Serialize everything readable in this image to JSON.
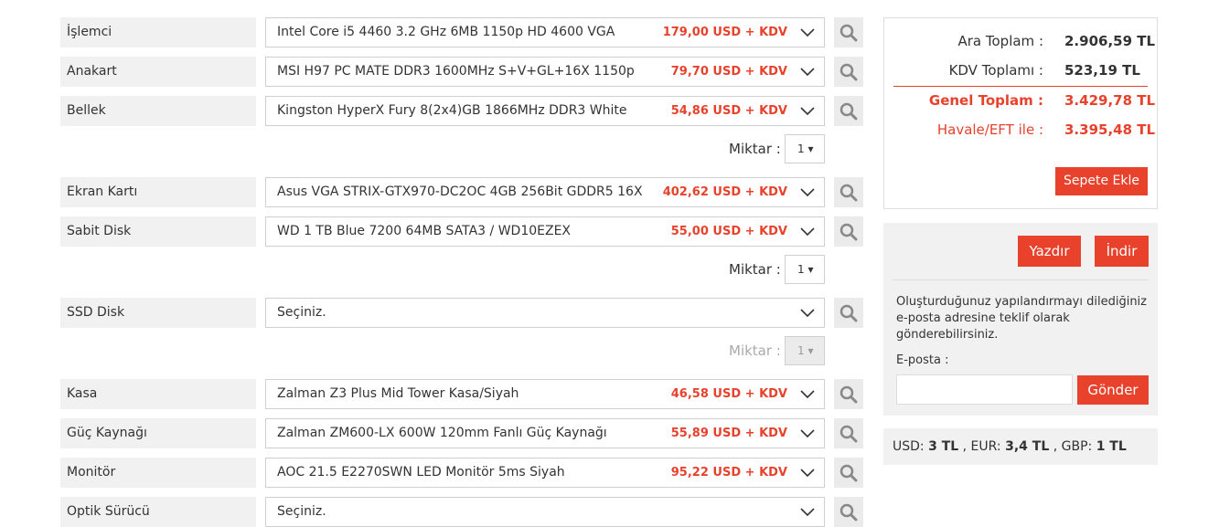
{
  "components": [
    {
      "label": "İşlemci",
      "product": "Intel Core i5 4460 3.2 GHz 6MB 1150p HD 4600 VGA",
      "price": "179,00 USD + KDV"
    },
    {
      "label": "Anakart",
      "product": "MSI H97 PC MATE DDR3 1600MHz S+V+GL+16X 1150p",
      "price": "79,70 USD + KDV"
    },
    {
      "label": "Bellek",
      "product": "Kingston HyperX Fury 8(2x4)GB 1866MHz DDR3 White",
      "price": "54,86 USD + KDV"
    },
    {
      "label": "Ekran Kartı",
      "product": "Asus VGA STRIX-GTX970-DC2OC 4GB 256Bit GDDR5 16X",
      "price": "402,62 USD + KDV"
    },
    {
      "label": "Sabit Disk",
      "product": "WD 1 TB Blue 7200 64MB SATA3 / WD10EZEX",
      "price": "55,00 USD + KDV"
    },
    {
      "label": "SSD Disk",
      "product": "Seçiniz.",
      "price": ""
    },
    {
      "label": "Kasa",
      "product": "Zalman Z3 Plus Mid Tower Kasa/Siyah",
      "price": "46,58 USD + KDV"
    },
    {
      "label": "Güç Kaynağı",
      "product": "Zalman ZM600-LX 600W 120mm Fanlı Güç Kaynağı",
      "price": "55,89 USD + KDV"
    },
    {
      "label": "Monitör",
      "product": "AOC 21.5 E2270SWN LED Monitör 5ms Siyah",
      "price": "95,22 USD + KDV"
    },
    {
      "label": "Optik Sürücü",
      "product": "Seçiniz.",
      "price": ""
    }
  ],
  "quantity": {
    "label": "Miktar :",
    "bellek": "1 ▾",
    "sabit_disk": "1 ▾",
    "ssd_disk": "1 ▾"
  },
  "summary": {
    "subtotal_label": "Ara Toplam :",
    "subtotal_value": "2.906,59 TL",
    "tax_label": "KDV Toplamı :",
    "tax_value": "523,19 TL",
    "total_label": "Genel Toplam :",
    "total_value": "3.429,78 TL",
    "transfer_label": "Havale/EFT ile :",
    "transfer_value": "3.395,48 TL",
    "add_to_cart": "Sepete Ekle"
  },
  "share": {
    "print": "Yazdır",
    "download": "İndir",
    "description": "Oluşturduğunuz yapılandırmayı dilediğiniz e-posta adresine teklif olarak gönderebilirsiniz.",
    "email_label": "E-posta :",
    "email_value": "",
    "send": "Gönder"
  },
  "rates": {
    "usd_label": "USD:",
    "usd_value": "3 TL",
    "eur_label": ", EUR:",
    "eur_value": "3,4 TL",
    "gbp_label": ", GBP:",
    "gbp_value": "1 TL"
  },
  "colors": {
    "accent": "#e8412c",
    "panel": "#f1f1f1"
  }
}
